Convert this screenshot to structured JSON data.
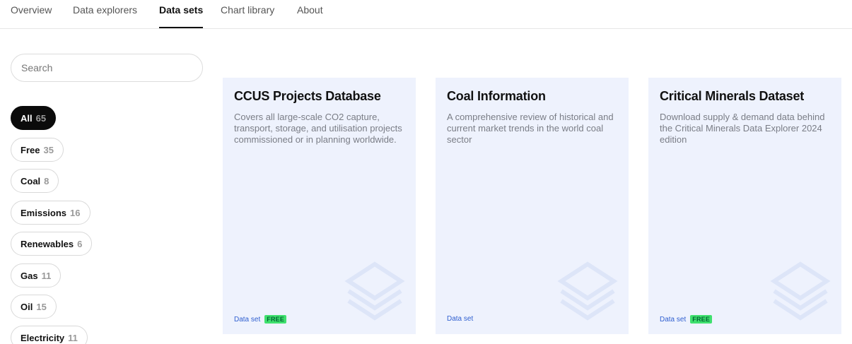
{
  "nav": {
    "tabs": [
      {
        "label": "Overview",
        "active": false
      },
      {
        "label": "Data explorers",
        "active": false
      },
      {
        "label": "Data sets",
        "active": true
      },
      {
        "label": "Chart library",
        "active": false
      },
      {
        "label": "About",
        "active": false
      }
    ]
  },
  "search": {
    "placeholder": "Search",
    "value": ""
  },
  "filters": [
    {
      "label": "All",
      "count": "65",
      "active": true
    },
    {
      "label": "Free",
      "count": "35",
      "active": false
    },
    {
      "label": "Coal",
      "count": "8",
      "active": false
    },
    {
      "label": "Emissions",
      "count": "16",
      "active": false
    },
    {
      "label": "Renewables",
      "count": "6",
      "active": false
    },
    {
      "label": "Gas",
      "count": "11",
      "active": false
    },
    {
      "label": "Oil",
      "count": "15",
      "active": false
    },
    {
      "label": "Electricity",
      "count": "11",
      "active": false
    }
  ],
  "cards": [
    {
      "title": "CCUS Projects Database",
      "description": "Covers all large-scale CO2 capture, transport, storage, and utilisation projects commissioned or in planning worldwide.",
      "type": "Data set",
      "badge": "FREE",
      "icon": "layers-icon"
    },
    {
      "title": "Coal Information",
      "description": "A comprehensive review of historical and current market trends in the world coal sector",
      "type": "Data set",
      "badge": "",
      "icon": "layers-icon"
    },
    {
      "title": "Critical Minerals Dataset",
      "description": "Download supply & demand data behind the Critical Minerals Data Explorer 2024 edition",
      "type": "Data set",
      "badge": "FREE",
      "icon": "layers-icon"
    }
  ],
  "colors": {
    "card_bg": "#eef2fd",
    "active_pill": "#0b0b0b",
    "badge": "#3fe06e",
    "link": "#2f5fd0"
  }
}
